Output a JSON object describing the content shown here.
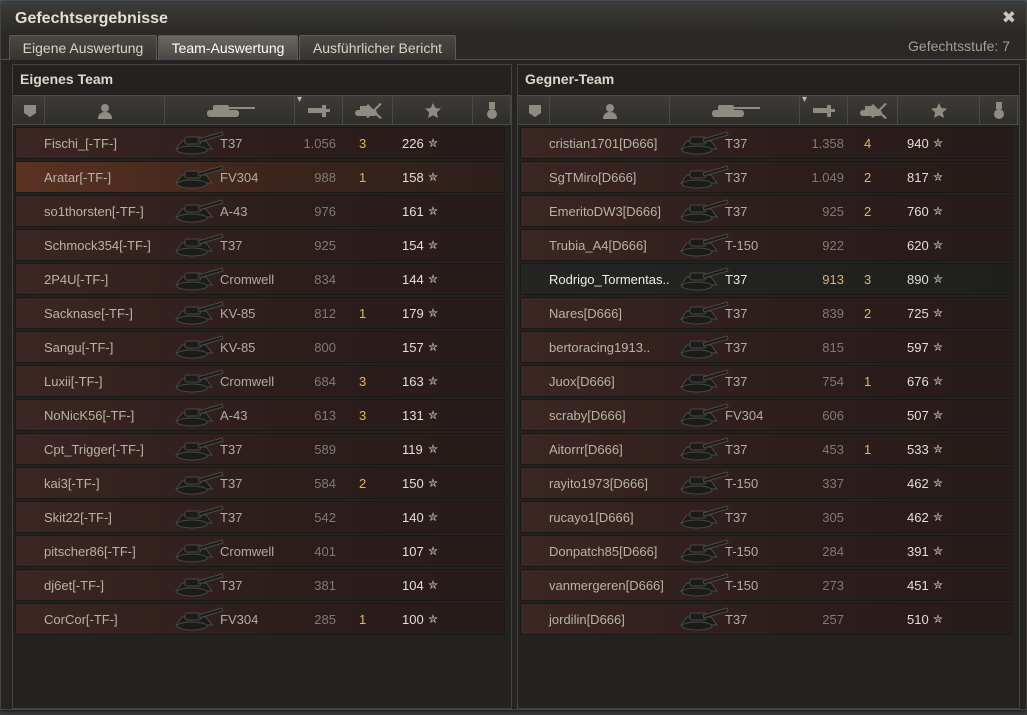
{
  "window": {
    "title": "Gefechtsergebnisse",
    "close_glyph": "✖"
  },
  "tabs": [
    {
      "label": "Eigene Auswertung",
      "active": false
    },
    {
      "label": "Team-Auswertung",
      "active": true
    },
    {
      "label": "Ausführlicher Bericht",
      "active": false
    }
  ],
  "battle_tier": "Gefechtsstufe: 7",
  "teams": {
    "own": {
      "title": "Eigenes Team",
      "rows": [
        {
          "player": "Fischi_[-TF-]",
          "tank": "T37",
          "damage": "1.056",
          "kills": "3",
          "xp": "226"
        },
        {
          "player": "Aratar[-TF-]",
          "tank": "FV304",
          "damage": "988",
          "kills": "1",
          "xp": "158"
        },
        {
          "player": "so1thorsten[-TF-]",
          "tank": "A-43",
          "damage": "976",
          "kills": "",
          "xp": "161"
        },
        {
          "player": "Schmock354[-TF-]",
          "tank": "T37",
          "damage": "925",
          "kills": "",
          "xp": "154"
        },
        {
          "player": "2P4U[-TF-]",
          "tank": "Cromwell",
          "damage": "834",
          "kills": "",
          "xp": "144"
        },
        {
          "player": "Sacknase[-TF-]",
          "tank": "KV-85",
          "damage": "812",
          "kills": "1",
          "xp": "179"
        },
        {
          "player": "Sangu[-TF-]",
          "tank": "KV-85",
          "damage": "800",
          "kills": "",
          "xp": "157"
        },
        {
          "player": "Luxii[-TF-]",
          "tank": "Cromwell",
          "damage": "684",
          "kills": "3",
          "xp": "163"
        },
        {
          "player": "NoNicK56[-TF-]",
          "tank": "A-43",
          "damage": "613",
          "kills": "3",
          "xp": "131"
        },
        {
          "player": "Cpt_Trigger[-TF-]",
          "tank": "T37",
          "damage": "589",
          "kills": "",
          "xp": "119"
        },
        {
          "player": "kai3[-TF-]",
          "tank": "T37",
          "damage": "584",
          "kills": "2",
          "xp": "150"
        },
        {
          "player": "Skit22[-TF-]",
          "tank": "T37",
          "damage": "542",
          "kills": "",
          "xp": "140"
        },
        {
          "player": "pitscher86[-TF-]",
          "tank": "Cromwell",
          "damage": "401",
          "kills": "",
          "xp": "107"
        },
        {
          "player": "dj6et[-TF-]",
          "tank": "T37",
          "damage": "381",
          "kills": "",
          "xp": "104"
        },
        {
          "player": "CorCor[-TF-]",
          "tank": "FV304",
          "damage": "285",
          "kills": "1",
          "xp": "100"
        }
      ]
    },
    "enemy": {
      "title": "Gegner-Team",
      "rows": [
        {
          "player": "cristian1701[D666]",
          "tank": "T37",
          "damage": "1.358",
          "kills": "4",
          "xp": "940"
        },
        {
          "player": "SgTMiro[D666]",
          "tank": "T37",
          "damage": "1.049",
          "kills": "2",
          "xp": "817"
        },
        {
          "player": "EmeritoDW3[D666]",
          "tank": "T37",
          "damage": "925",
          "kills": "2",
          "xp": "760"
        },
        {
          "player": "Trubia_A4[D666]",
          "tank": "T-150",
          "damage": "922",
          "kills": "",
          "xp": "620"
        },
        {
          "player": "Rodrigo_Tormentas..",
          "tank": "T37",
          "damage": "913",
          "kills": "3",
          "xp": "890"
        },
        {
          "player": "Nares[D666]",
          "tank": "T37",
          "damage": "839",
          "kills": "2",
          "xp": "725"
        },
        {
          "player": "bertoracing1913..",
          "tank": "T37",
          "damage": "815",
          "kills": "",
          "xp": "597"
        },
        {
          "player": "Juox[D666]",
          "tank": "T37",
          "damage": "754",
          "kills": "1",
          "xp": "676"
        },
        {
          "player": "scraby[D666]",
          "tank": "FV304",
          "damage": "606",
          "kills": "",
          "xp": "507"
        },
        {
          "player": "Aitorrr[D666]",
          "tank": "T37",
          "damage": "453",
          "kills": "1",
          "xp": "533"
        },
        {
          "player": "rayito1973[D666]",
          "tank": "T-150",
          "damage": "337",
          "kills": "",
          "xp": "462"
        },
        {
          "player": "rucayo1[D666]",
          "tank": "T37",
          "damage": "305",
          "kills": "",
          "xp": "462"
        },
        {
          "player": "Donpatch85[D666]",
          "tank": "T-150",
          "damage": "284",
          "kills": "",
          "xp": "391"
        },
        {
          "player": "vanmergeren[D666]",
          "tank": "T-150",
          "damage": "273",
          "kills": "",
          "xp": "451"
        },
        {
          "player": "jordilin[D666]",
          "tank": "T37",
          "damage": "257",
          "kills": "",
          "xp": "510"
        }
      ]
    }
  },
  "column_icons": [
    "squad-icon",
    "player-icon",
    "tank-icon",
    "damage-icon",
    "kills-icon",
    "xp-icon",
    "medal-icon"
  ],
  "xp_icon_glyph": "✮",
  "highlight_rows": {
    "own_self_index": 1,
    "enemy_top_index": 4
  },
  "colors": {
    "kills": "#e1b65a",
    "top_damage": "#d9b264",
    "self_row": "#5a3222"
  }
}
